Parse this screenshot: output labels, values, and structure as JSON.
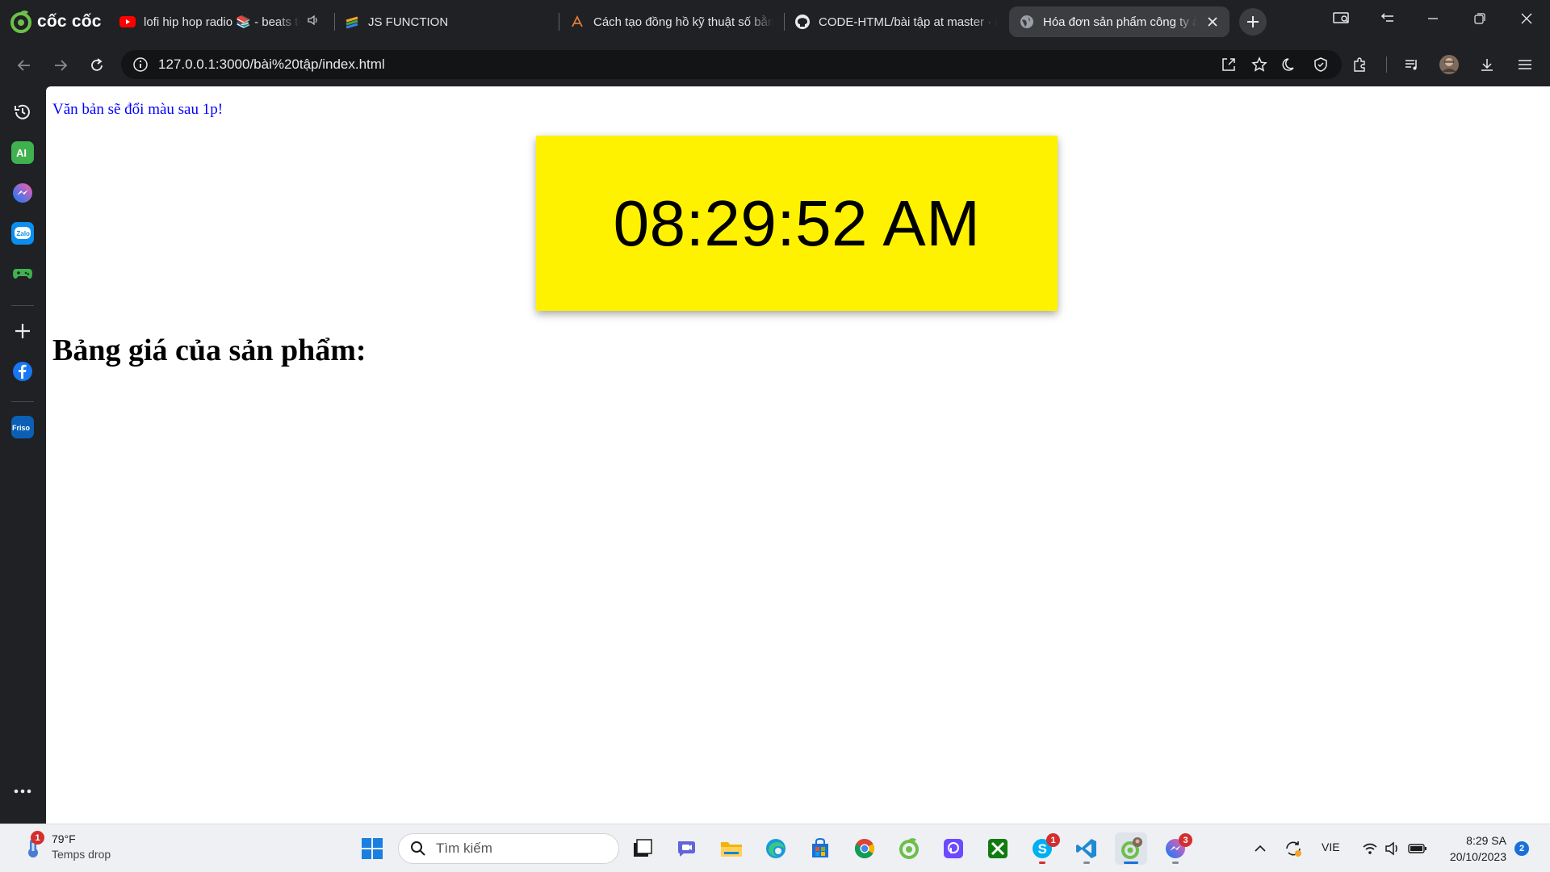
{
  "browser": {
    "brand": "cốc cốc",
    "tabs": [
      {
        "title": "lofi hip hop radio 📚 - beats to relax/study to",
        "icon": "youtube-icon"
      },
      {
        "title": "JS FUNCTION",
        "icon": "stack-icon"
      },
      {
        "title": "Cách tạo đồng hồ kỹ thuật số bằng JavaScript",
        "icon": "web-icon"
      },
      {
        "title": "CODE-HTML/bài tập at master · main",
        "icon": "github-icon"
      },
      {
        "title": "Hóa đơn sản phẩm công ty ảo",
        "icon": "globe-icon",
        "active": true
      }
    ],
    "url": "127.0.0.1:3000/bài%20tập/index.html"
  },
  "page": {
    "notice": "Văn bản sẽ đổi màu sau 1p!",
    "clock_time": "08:29:52 AM",
    "clock_bg": "#fff200",
    "heading": "Bảng giá của sản phẩm:"
  },
  "taskbar": {
    "weather_temp": "79°F",
    "weather_desc": "Temps drop",
    "weather_badge": "1",
    "search_placeholder": "Tìm kiếm",
    "skype_badge": "1",
    "messenger_badge": "3",
    "language": "VIE",
    "time": "8:29 SA",
    "date": "20/10/2023",
    "notification_count": "2"
  }
}
